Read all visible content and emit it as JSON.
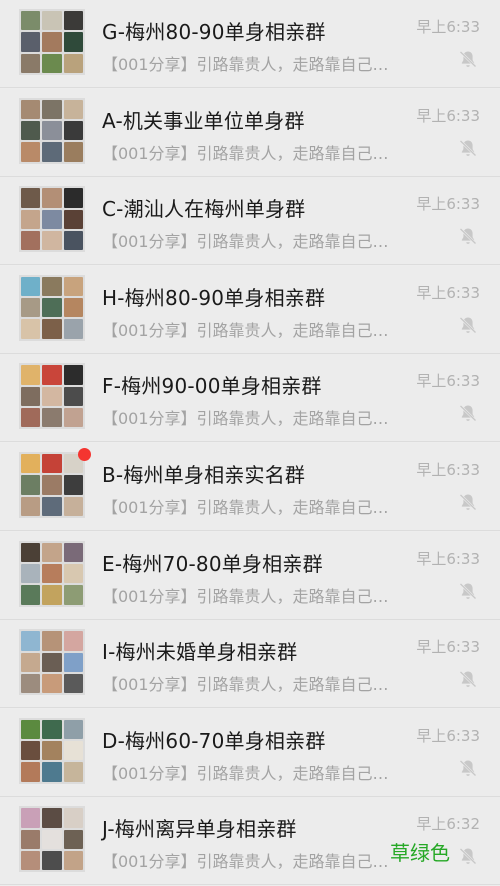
{
  "chats": [
    {
      "title": "G-梅州80-90单身相亲群",
      "preview": "【001分享】引路靠贵人，走路靠自己…",
      "time": "早上6:33",
      "muted": true,
      "unread": false,
      "avatar_colors": [
        "#7b8c6a",
        "#c9c4b5",
        "#3b3a38",
        "#5a5f6b",
        "#a37a5e",
        "#2f4a3a",
        "#8a7a68",
        "#6b8a4e",
        "#b9a27c"
      ]
    },
    {
      "title": "A-机关事业单位单身群",
      "preview": "【001分享】引路靠贵人，走路靠自己…",
      "time": "早上6:33",
      "muted": true,
      "unread": false,
      "avatar_colors": [
        "#a58a72",
        "#7c7466",
        "#c7b39a",
        "#4f5a4d",
        "#8b8f99",
        "#3a3a3a",
        "#b98a68",
        "#5d6a78",
        "#9a7d5e"
      ]
    },
    {
      "title": "C-潮汕人在梅州单身群",
      "preview": "【001分享】引路靠贵人，走路靠自己…",
      "time": "早上6:33",
      "muted": true,
      "unread": false,
      "avatar_colors": [
        "#6e5a4a",
        "#b38f76",
        "#2b2b2b",
        "#c4a58c",
        "#7d8aa1",
        "#5a4136",
        "#a2705e",
        "#d0b6a0",
        "#4a5360"
      ]
    },
    {
      "title": "H-梅州80-90单身相亲群",
      "preview": "【001分享】引路靠贵人，走路靠自己…",
      "time": "早上6:33",
      "muted": true,
      "unread": false,
      "avatar_colors": [
        "#6fb0c9",
        "#8a7a5e",
        "#c8a37d",
        "#a79a86",
        "#4e6e57",
        "#b58660",
        "#d8c3a8",
        "#7c6049",
        "#9aa3ab"
      ]
    },
    {
      "title": "F-梅州90-00单身相亲群",
      "preview": "【001分享】引路靠贵人，走路靠自己…",
      "time": "早上6:33",
      "muted": true,
      "unread": false,
      "avatar_colors": [
        "#e0b36a",
        "#c9453a",
        "#2c2c2c",
        "#7e6d5f",
        "#d3b7a1",
        "#4c4c4c",
        "#a06a5a",
        "#8b7b6e",
        "#c1a291"
      ]
    },
    {
      "title": "B-梅州单身相亲实名群",
      "preview": "【001分享】引路靠贵人，走路靠自己…",
      "time": "早上6:33",
      "muted": true,
      "unread": true,
      "avatar_colors": [
        "#e2b05c",
        "#c54237",
        "#d7d2c8",
        "#6c7e63",
        "#9b7b65",
        "#3d3d3d",
        "#b89c84",
        "#5e6b7a",
        "#c6b09a"
      ]
    },
    {
      "title": "E-梅州70-80单身相亲群",
      "preview": "【001分享】引路靠贵人，走路靠自己…",
      "time": "早上6:33",
      "muted": true,
      "unread": false,
      "avatar_colors": [
        "#4b4036",
        "#c3a48a",
        "#7a6a78",
        "#a9b3bb",
        "#b77d5c",
        "#d8c8b0",
        "#5a7a5a",
        "#c2a35e",
        "#8d9c74"
      ]
    },
    {
      "title": "I-梅州未婚单身相亲群",
      "preview": "【001分享】引路靠贵人，走路靠自己…",
      "time": "早上6:33",
      "muted": true,
      "unread": false,
      "avatar_colors": [
        "#8fb6d1",
        "#b69378",
        "#d4a6a0",
        "#c5a98f",
        "#6a5e54",
        "#7fa0c8",
        "#9c8c7e",
        "#c89b7a",
        "#5a5a5a"
      ]
    },
    {
      "title": "D-梅州60-70单身相亲群",
      "preview": "【001分享】引路靠贵人，走路靠自己…",
      "time": "早上6:33",
      "muted": true,
      "unread": false,
      "avatar_colors": [
        "#5b8a3f",
        "#3f6a4e",
        "#8f9fa8",
        "#6a4e3e",
        "#a3825e",
        "#e7e1d6",
        "#b37a5a",
        "#4e7a8f",
        "#c6b59b"
      ]
    },
    {
      "title": "J-梅州离异单身相亲群",
      "preview": "【001分享】引路靠贵人，走路靠自己…",
      "time": "早上6:32",
      "muted": true,
      "unread": false,
      "avatar_colors": [
        "#c9a0b7",
        "#5b4c44",
        "#d8cfc6",
        "#9a7b6a",
        "#e4e0dd",
        "#6d6154",
        "#b58e7a",
        "#4d4d4d",
        "#c2a388"
      ]
    }
  ],
  "watermark": "草绿色",
  "icons": {
    "mute": "bell-off-icon",
    "avatar": "group-avatar-grid"
  }
}
